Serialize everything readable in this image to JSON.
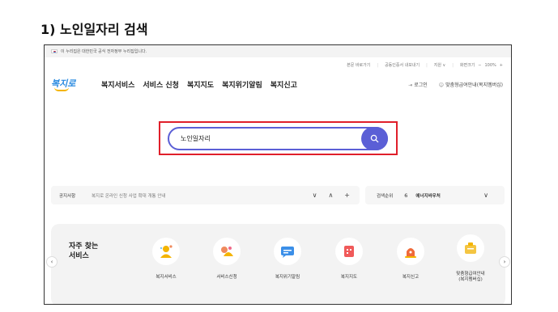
{
  "doc_heading": "1) 노인일자리 검색",
  "gov_banner": "이 누리집은 대한민국 공식 전자정부 누리집입니다.",
  "util": {
    "shortcut": "본문 바로가기",
    "certificate": "공동인증서 내보내기",
    "language": "지원 ∨",
    "zoom_label": "화면크기",
    "zoom_minus": "−",
    "zoom_value": "100%",
    "zoom_plus": "+"
  },
  "logo": "복지로",
  "gnb": [
    "복지서비스",
    "서비스 신청",
    "복지지도",
    "복지위기알림",
    "복지신고"
  ],
  "header_right": {
    "login": "로그인",
    "custom_benefit": "맞춤형급여안내(복지멤버십)"
  },
  "search": {
    "value": "노인일자리"
  },
  "notice": {
    "label": "공지사항",
    "text": "복지로 온라인 신청 사업 확대 개통 안내",
    "down": "∨",
    "up": "∧",
    "plus": "+"
  },
  "ranking": {
    "label": "검색순위",
    "rank": "6",
    "keyword": "에너지바우처",
    "chevron": "∨"
  },
  "services": {
    "title": "자주 찾는\n서비스",
    "prev": "‹",
    "next": "›",
    "items": [
      {
        "label": "복지서비스",
        "icon": "person-star-icon",
        "color": "#f4b400"
      },
      {
        "label": "서비스신청",
        "icon": "apply-icon",
        "color": "#f08a5d"
      },
      {
        "label": "복지위기알림",
        "icon": "chat-alert-icon",
        "color": "#3b8fe8"
      },
      {
        "label": "복지지도",
        "icon": "map-icon",
        "color": "#f05a5a"
      },
      {
        "label": "복지신고",
        "icon": "siren-icon",
        "color": "#f06a3a"
      },
      {
        "label": "맞춤형급여안내\n(복지멤버십)",
        "icon": "membership-icon",
        "color": "#f4c542"
      }
    ]
  }
}
